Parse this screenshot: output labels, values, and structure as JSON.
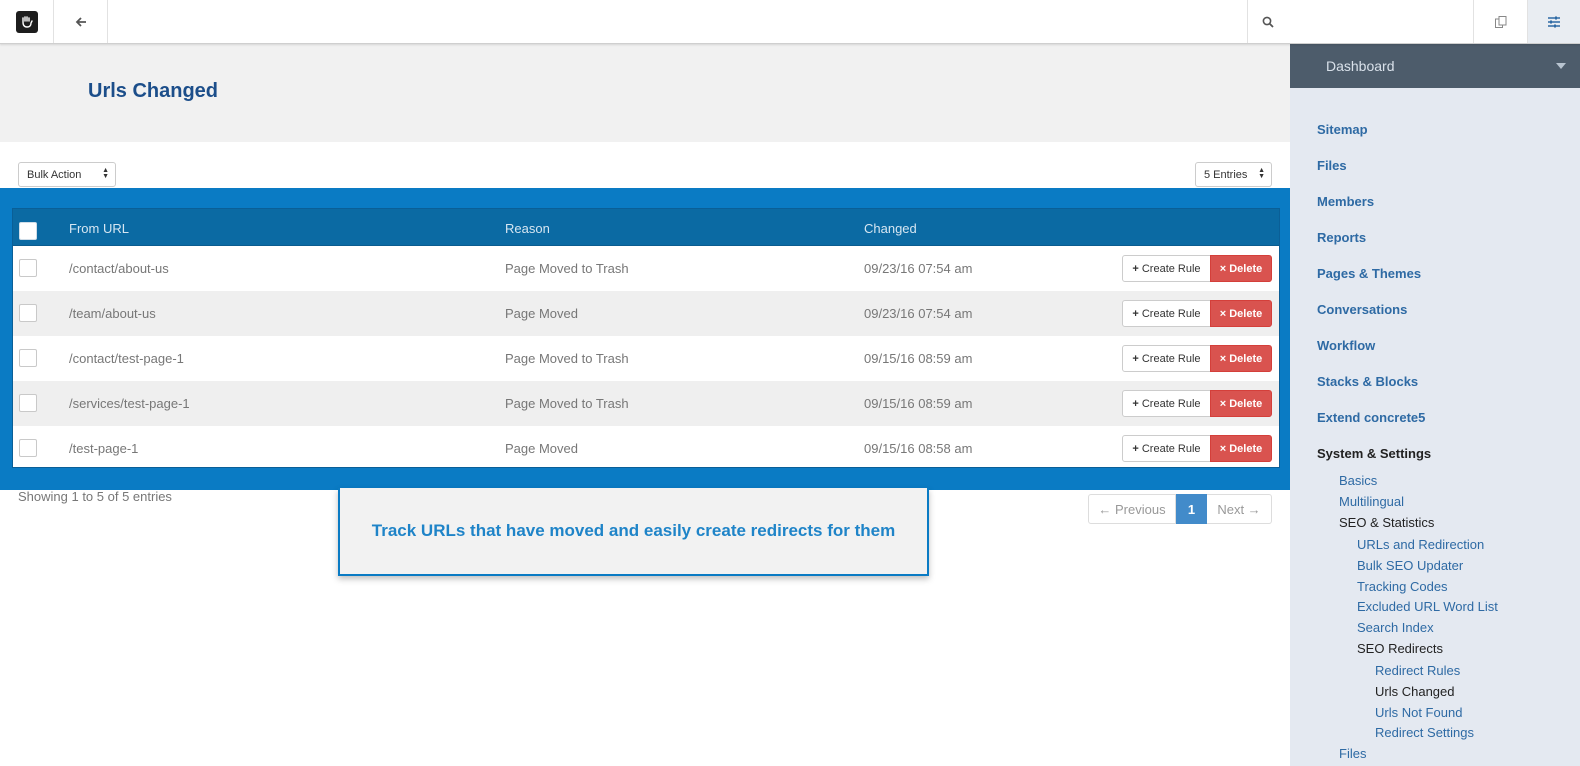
{
  "toolbar": {
    "logo_icon": "concrete5-hand-logo",
    "back_icon": "arrow-left-icon",
    "search_icon": "search-icon",
    "pages_icon": "copy-pages-icon",
    "settings_icon": "sliders-icon"
  },
  "page": {
    "title": "Urls Changed"
  },
  "controls": {
    "bulk_action": "Bulk Action",
    "entries": "5 Entries"
  },
  "table": {
    "headers": {
      "from_url": "From URL",
      "reason": "Reason",
      "changed": "Changed"
    },
    "rows": [
      {
        "from_url": "/contact/about-us",
        "reason": "Page Moved to Trash",
        "changed": "09/23/16 07:54 am"
      },
      {
        "from_url": "/team/about-us",
        "reason": "Page Moved",
        "changed": "09/23/16 07:54 am"
      },
      {
        "from_url": "/contact/test-page-1",
        "reason": "Page Moved to Trash",
        "changed": "09/15/16 08:59 am"
      },
      {
        "from_url": "/services/test-page-1",
        "reason": "Page Moved to Trash",
        "changed": "09/15/16 08:59 am"
      },
      {
        "from_url": "/test-page-1",
        "reason": "Page Moved",
        "changed": "09/15/16 08:58 am"
      }
    ],
    "create_rule_label": "Create Rule",
    "delete_label": "Delete"
  },
  "footer": {
    "showing": "Showing 1 to 5 of 5 entries"
  },
  "pagination": {
    "previous": "← Previous",
    "current": "1",
    "next": "Next →"
  },
  "callout": {
    "text": "Track URLs that have moved and easily create redirects for them"
  },
  "panel": {
    "header": "Dashboard",
    "items": [
      "Sitemap",
      "Files",
      "Members",
      "Reports",
      "Pages & Themes",
      "Conversations",
      "Workflow",
      "Stacks & Blocks",
      "Extend concrete5",
      "System & Settings"
    ],
    "system": [
      "Basics",
      "Multilingual",
      "SEO & Statistics"
    ],
    "seo": [
      "URLs and Redirection",
      "Bulk SEO Updater",
      "Tracking Codes",
      "Excluded URL Word List",
      "Search Index",
      "SEO Redirects"
    ],
    "redirects": [
      "Redirect Rules",
      "Urls Changed",
      "Urls Not Found",
      "Redirect Settings"
    ],
    "files": "Files"
  },
  "colors": {
    "accent": "#0a7bc4",
    "header_row": "#0b6aa3",
    "delete": "#d9534f",
    "title": "#1c4e8a",
    "panel_head": "#4d5c6b"
  }
}
